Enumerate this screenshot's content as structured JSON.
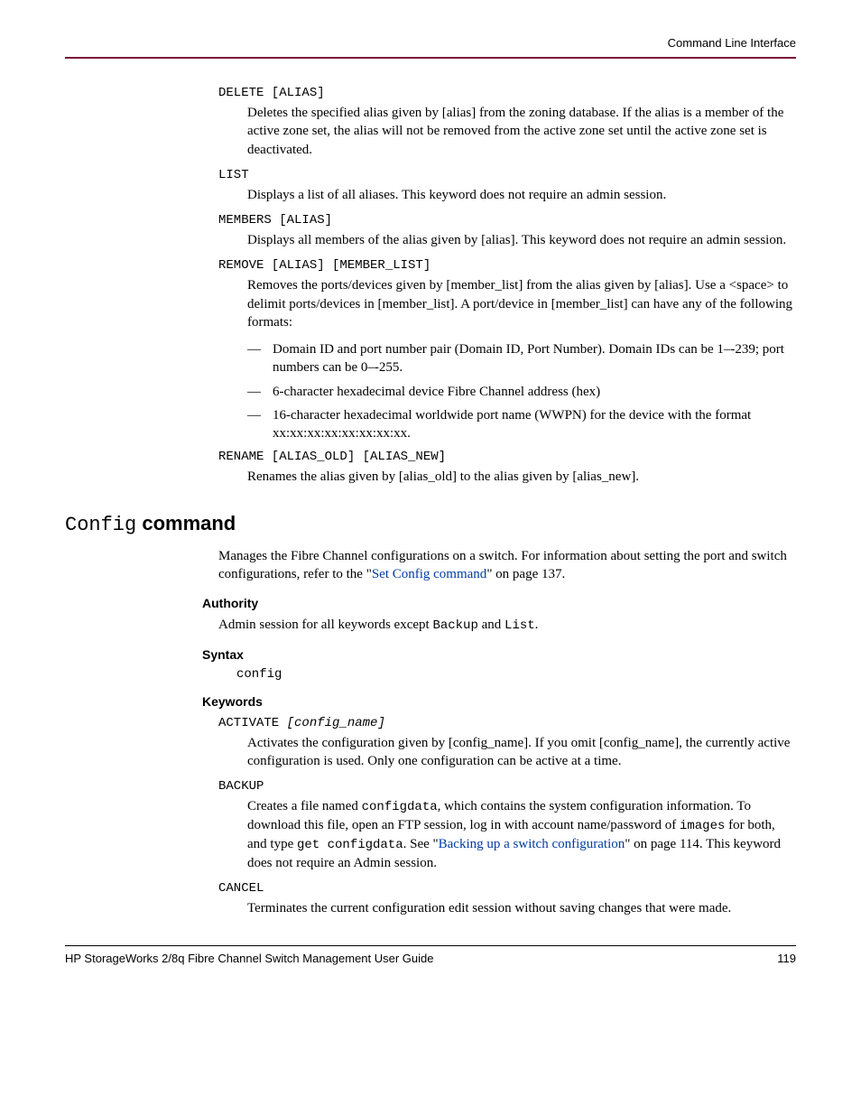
{
  "header": {
    "section_title": "Command Line Interface"
  },
  "keywords_top": {
    "delete": {
      "term": "DELETE [ALIAS]",
      "desc": "Deletes the specified alias given by [alias] from the zoning database. If the alias is a member of the active zone set, the alias will not be removed from the active zone set until the active zone set is deactivated."
    },
    "list": {
      "term": "LIST",
      "desc": "Displays a list of all aliases. This keyword does not require an admin session."
    },
    "members": {
      "term": "MEMBERS [ALIAS]",
      "desc": "Displays all members of the alias given by [alias]. This keyword does not require an admin session."
    },
    "remove": {
      "term": "REMOVE [ALIAS] [MEMBER_LIST]",
      "desc": "Removes the ports/devices given by [member_list] from the alias given by [alias]. Use a <space> to delimit ports/devices in [member_list]. A port/device in [member_list] can have any of the following formats:",
      "bullets": [
        "Domain ID and port number pair (Domain ID, Port Number). Domain IDs can be 1–-239; port numbers can be 0–-255.",
        "6-character hexadecimal device Fibre Channel address (hex)",
        "16-character hexadecimal worldwide port name (WWPN) for the device with the format xx:xx:xx:xx:xx:xx:xx:xx."
      ]
    },
    "rename": {
      "term": "RENAME [ALIAS_OLD] [ALIAS_NEW]",
      "desc": "Renames the alias given by [alias_old] to the alias given by [alias_new]."
    }
  },
  "config_section": {
    "heading_mono": "Config",
    "heading_bold": " command",
    "intro_pre": "Manages the Fibre Channel configurations on a switch. For information about setting the port and switch configurations, refer to the \"",
    "intro_link": "Set Config command",
    "intro_post": "\" on page 137.",
    "authority": {
      "label": "Authority",
      "text_pre": "Admin session for all keywords except ",
      "code1": "Backup",
      "mid": " and ",
      "code2": "List",
      "post": "."
    },
    "syntax": {
      "label": "Syntax",
      "value": "config"
    },
    "keywords": {
      "label": "Keywords",
      "activate": {
        "term": "ACTIVATE ",
        "term_italic": "[config_name]",
        "desc": "Activates the configuration given by [config_name]. If you omit [config_name], the currently active configuration is used. Only one configuration can be active at a time."
      },
      "backup": {
        "term": "BACKUP",
        "desc_pre": "Creates a file named ",
        "code1": "configdata",
        "desc_mid1": ", which contains the system configuration information. To download this file, open an FTP session, log in with account name/password of ",
        "code2": "images",
        "desc_mid2": " for both, and type ",
        "code3": "get configdata",
        "desc_mid3": ". See \"",
        "link": "Backing up a switch configuration",
        "desc_post": "\" on page 114. This keyword does not require an Admin session."
      },
      "cancel": {
        "term": "CANCEL",
        "desc": "Terminates the current configuration edit session without saving changes that were made."
      }
    }
  },
  "footer": {
    "left": "HP StorageWorks 2/8q Fibre Channel Switch Management User Guide",
    "right": "119"
  }
}
